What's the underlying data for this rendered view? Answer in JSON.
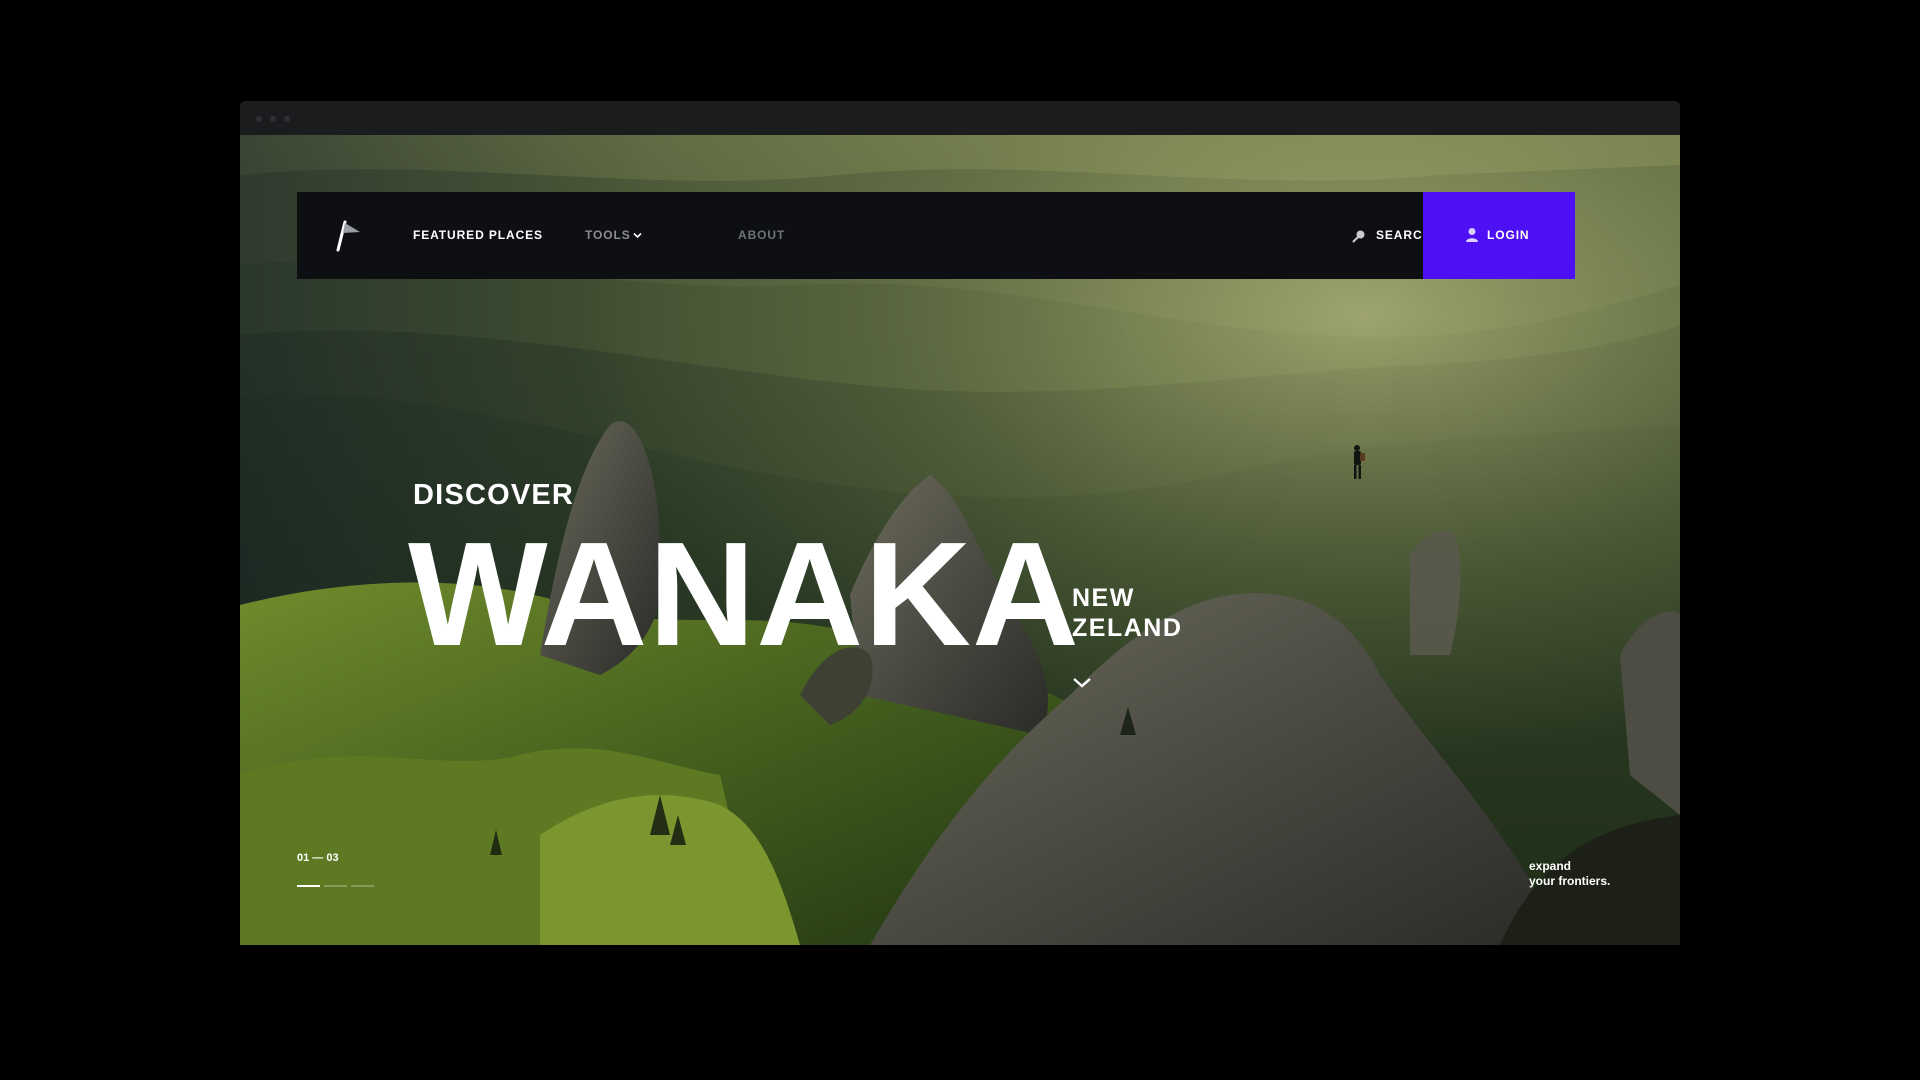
{
  "browser": {
    "dots": [
      "#2e2f32",
      "#2e2f32",
      "#2e2f32"
    ]
  },
  "colors": {
    "accent": "#4d0ff3",
    "navbar": "#0d0f12",
    "text": "#ffffff",
    "muted_nav": "#8b8d92"
  },
  "nav": {
    "logo_icon": "flag-logo-icon",
    "items": [
      {
        "label": "FEATURED PLACES"
      },
      {
        "label": "TOOLS",
        "icon": "chevron-down-icon"
      },
      {
        "label": "ABOUT"
      }
    ],
    "search": {
      "label": "SEARCH",
      "icon": "search-icon"
    },
    "login": {
      "label": "LOGIN",
      "icon": "user-icon"
    }
  },
  "hero": {
    "kicker": "DISCOVER",
    "title": "WANAKA",
    "country_lines": [
      "NEW",
      "ZELAND"
    ],
    "scroll_icon": "chevron-down-icon"
  },
  "slider": {
    "counter": "01 — 03",
    "current": 1,
    "total": 3
  },
  "tagline": {
    "lines": [
      "expand",
      "your frontiers."
    ]
  }
}
